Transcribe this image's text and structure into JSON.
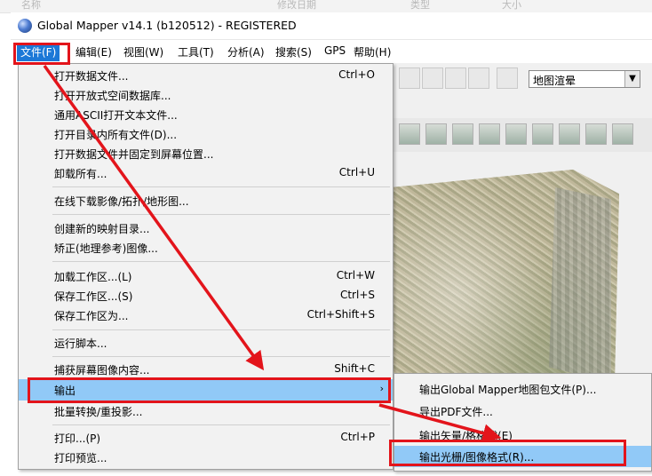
{
  "background_strip": [
    "名称",
    "修改日期",
    "类型",
    "大小"
  ],
  "window": {
    "title": "Global Mapper v14.1 (b120512) - REGISTERED"
  },
  "menubar": [
    "文件(F)",
    "编辑(E)",
    "视图(W)",
    "工具(T)",
    "分析(A)",
    "搜索(S)",
    "GPS",
    "帮助(H)"
  ],
  "toolbar": {
    "layer_combo": "地图渲晕"
  },
  "file_menu": {
    "items": [
      {
        "label": "打开数据文件...",
        "shortcut": "Ctrl+O"
      },
      {
        "label": "打开开放式空间数据库...",
        "shortcut": ""
      },
      {
        "label": "通用ASCII打开文本文件...",
        "shortcut": ""
      },
      {
        "label": "打开目录内所有文件(D)...",
        "shortcut": ""
      },
      {
        "label": "打开数据文件并固定到屏幕位置...",
        "shortcut": ""
      },
      {
        "label": "卸载所有...",
        "shortcut": "Ctrl+U"
      },
      {
        "label": "在线下载影像/拓扑/地形图...",
        "shortcut": ""
      },
      {
        "label": "创建新的映射目录...",
        "shortcut": ""
      },
      {
        "label": "矫正(地理参考)图像...",
        "shortcut": ""
      },
      {
        "label": "加载工作区...(L)",
        "shortcut": "Ctrl+W"
      },
      {
        "label": "保存工作区...(S)",
        "shortcut": "Ctrl+S"
      },
      {
        "label": "保存工作区为...",
        "shortcut": "Ctrl+Shift+S"
      },
      {
        "label": "运行脚本...",
        "shortcut": ""
      },
      {
        "label": "捕获屏幕图像内容...",
        "shortcut": "Shift+C"
      },
      {
        "label": "输出",
        "shortcut": "",
        "submenu_arrow": "›"
      },
      {
        "label": "批量转换/重投影...",
        "shortcut": ""
      },
      {
        "label": "打印...(P)",
        "shortcut": "Ctrl+P"
      },
      {
        "label": "打印预览...",
        "shortcut": ""
      }
    ]
  },
  "export_submenu": {
    "items": [
      {
        "label": "输出Global Mapper地图包文件(P)..."
      },
      {
        "label": "导出PDF文件..."
      },
      {
        "label": "输出矢量/格格式(E)"
      },
      {
        "label": "输出光栅/图像格式(R)..."
      }
    ]
  },
  "colors": {
    "highlight": "#91c9f7",
    "menu_active": "#1c78d7",
    "annotation": "#e3141b"
  }
}
